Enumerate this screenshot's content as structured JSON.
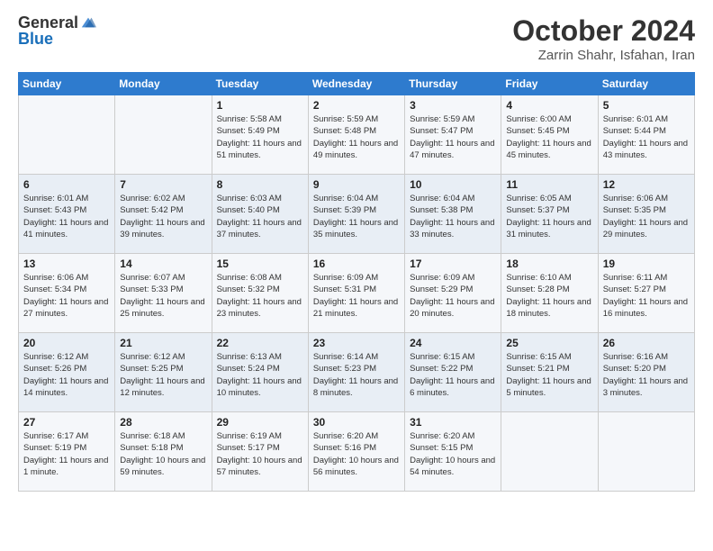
{
  "logo": {
    "text_general": "General",
    "text_blue": "Blue"
  },
  "header": {
    "month": "October 2024",
    "location": "Zarrin Shahr, Isfahan, Iran"
  },
  "weekdays": [
    "Sunday",
    "Monday",
    "Tuesday",
    "Wednesday",
    "Thursday",
    "Friday",
    "Saturday"
  ],
  "weeks": [
    [
      {
        "day": "",
        "sunrise": "",
        "sunset": "",
        "daylight": ""
      },
      {
        "day": "",
        "sunrise": "",
        "sunset": "",
        "daylight": ""
      },
      {
        "day": "1",
        "sunrise": "Sunrise: 5:58 AM",
        "sunset": "Sunset: 5:49 PM",
        "daylight": "Daylight: 11 hours and 51 minutes."
      },
      {
        "day": "2",
        "sunrise": "Sunrise: 5:59 AM",
        "sunset": "Sunset: 5:48 PM",
        "daylight": "Daylight: 11 hours and 49 minutes."
      },
      {
        "day": "3",
        "sunrise": "Sunrise: 5:59 AM",
        "sunset": "Sunset: 5:47 PM",
        "daylight": "Daylight: 11 hours and 47 minutes."
      },
      {
        "day": "4",
        "sunrise": "Sunrise: 6:00 AM",
        "sunset": "Sunset: 5:45 PM",
        "daylight": "Daylight: 11 hours and 45 minutes."
      },
      {
        "day": "5",
        "sunrise": "Sunrise: 6:01 AM",
        "sunset": "Sunset: 5:44 PM",
        "daylight": "Daylight: 11 hours and 43 minutes."
      }
    ],
    [
      {
        "day": "6",
        "sunrise": "Sunrise: 6:01 AM",
        "sunset": "Sunset: 5:43 PM",
        "daylight": "Daylight: 11 hours and 41 minutes."
      },
      {
        "day": "7",
        "sunrise": "Sunrise: 6:02 AM",
        "sunset": "Sunset: 5:42 PM",
        "daylight": "Daylight: 11 hours and 39 minutes."
      },
      {
        "day": "8",
        "sunrise": "Sunrise: 6:03 AM",
        "sunset": "Sunset: 5:40 PM",
        "daylight": "Daylight: 11 hours and 37 minutes."
      },
      {
        "day": "9",
        "sunrise": "Sunrise: 6:04 AM",
        "sunset": "Sunset: 5:39 PM",
        "daylight": "Daylight: 11 hours and 35 minutes."
      },
      {
        "day": "10",
        "sunrise": "Sunrise: 6:04 AM",
        "sunset": "Sunset: 5:38 PM",
        "daylight": "Daylight: 11 hours and 33 minutes."
      },
      {
        "day": "11",
        "sunrise": "Sunrise: 6:05 AM",
        "sunset": "Sunset: 5:37 PM",
        "daylight": "Daylight: 11 hours and 31 minutes."
      },
      {
        "day": "12",
        "sunrise": "Sunrise: 6:06 AM",
        "sunset": "Sunset: 5:35 PM",
        "daylight": "Daylight: 11 hours and 29 minutes."
      }
    ],
    [
      {
        "day": "13",
        "sunrise": "Sunrise: 6:06 AM",
        "sunset": "Sunset: 5:34 PM",
        "daylight": "Daylight: 11 hours and 27 minutes."
      },
      {
        "day": "14",
        "sunrise": "Sunrise: 6:07 AM",
        "sunset": "Sunset: 5:33 PM",
        "daylight": "Daylight: 11 hours and 25 minutes."
      },
      {
        "day": "15",
        "sunrise": "Sunrise: 6:08 AM",
        "sunset": "Sunset: 5:32 PM",
        "daylight": "Daylight: 11 hours and 23 minutes."
      },
      {
        "day": "16",
        "sunrise": "Sunrise: 6:09 AM",
        "sunset": "Sunset: 5:31 PM",
        "daylight": "Daylight: 11 hours and 21 minutes."
      },
      {
        "day": "17",
        "sunrise": "Sunrise: 6:09 AM",
        "sunset": "Sunset: 5:29 PM",
        "daylight": "Daylight: 11 hours and 20 minutes."
      },
      {
        "day": "18",
        "sunrise": "Sunrise: 6:10 AM",
        "sunset": "Sunset: 5:28 PM",
        "daylight": "Daylight: 11 hours and 18 minutes."
      },
      {
        "day": "19",
        "sunrise": "Sunrise: 6:11 AM",
        "sunset": "Sunset: 5:27 PM",
        "daylight": "Daylight: 11 hours and 16 minutes."
      }
    ],
    [
      {
        "day": "20",
        "sunrise": "Sunrise: 6:12 AM",
        "sunset": "Sunset: 5:26 PM",
        "daylight": "Daylight: 11 hours and 14 minutes."
      },
      {
        "day": "21",
        "sunrise": "Sunrise: 6:12 AM",
        "sunset": "Sunset: 5:25 PM",
        "daylight": "Daylight: 11 hours and 12 minutes."
      },
      {
        "day": "22",
        "sunrise": "Sunrise: 6:13 AM",
        "sunset": "Sunset: 5:24 PM",
        "daylight": "Daylight: 11 hours and 10 minutes."
      },
      {
        "day": "23",
        "sunrise": "Sunrise: 6:14 AM",
        "sunset": "Sunset: 5:23 PM",
        "daylight": "Daylight: 11 hours and 8 minutes."
      },
      {
        "day": "24",
        "sunrise": "Sunrise: 6:15 AM",
        "sunset": "Sunset: 5:22 PM",
        "daylight": "Daylight: 11 hours and 6 minutes."
      },
      {
        "day": "25",
        "sunrise": "Sunrise: 6:15 AM",
        "sunset": "Sunset: 5:21 PM",
        "daylight": "Daylight: 11 hours and 5 minutes."
      },
      {
        "day": "26",
        "sunrise": "Sunrise: 6:16 AM",
        "sunset": "Sunset: 5:20 PM",
        "daylight": "Daylight: 11 hours and 3 minutes."
      }
    ],
    [
      {
        "day": "27",
        "sunrise": "Sunrise: 6:17 AM",
        "sunset": "Sunset: 5:19 PM",
        "daylight": "Daylight: 11 hours and 1 minute."
      },
      {
        "day": "28",
        "sunrise": "Sunrise: 6:18 AM",
        "sunset": "Sunset: 5:18 PM",
        "daylight": "Daylight: 10 hours and 59 minutes."
      },
      {
        "day": "29",
        "sunrise": "Sunrise: 6:19 AM",
        "sunset": "Sunset: 5:17 PM",
        "daylight": "Daylight: 10 hours and 57 minutes."
      },
      {
        "day": "30",
        "sunrise": "Sunrise: 6:20 AM",
        "sunset": "Sunset: 5:16 PM",
        "daylight": "Daylight: 10 hours and 56 minutes."
      },
      {
        "day": "31",
        "sunrise": "Sunrise: 6:20 AM",
        "sunset": "Sunset: 5:15 PM",
        "daylight": "Daylight: 10 hours and 54 minutes."
      },
      {
        "day": "",
        "sunrise": "",
        "sunset": "",
        "daylight": ""
      },
      {
        "day": "",
        "sunrise": "",
        "sunset": "",
        "daylight": ""
      }
    ]
  ]
}
